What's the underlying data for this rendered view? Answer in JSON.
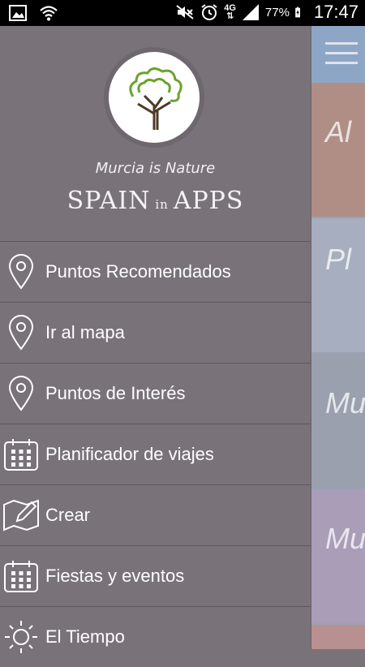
{
  "status_bar": {
    "network_type": "4G",
    "battery_percent": "77%",
    "time": "17:47",
    "icons": [
      "image-icon",
      "wifi-icon",
      "mute-icon",
      "alarm-icon",
      "signal-icon",
      "battery-charging-icon"
    ]
  },
  "drawer": {
    "tagline": "Murcia is Nature",
    "brand_main": "SPAIN",
    "brand_small": "in",
    "brand_end": "APPS",
    "items": [
      {
        "label": "Puntos Recomendados",
        "icon": "location-pin-icon"
      },
      {
        "label": "Ir al mapa",
        "icon": "location-pin-icon"
      },
      {
        "label": "Puntos de Interés",
        "icon": "location-pin-icon"
      },
      {
        "label": "Planificador de viajes",
        "icon": "calendar-icon"
      },
      {
        "label": "Crear",
        "icon": "edit-map-icon"
      },
      {
        "label": "Fiestas y eventos",
        "icon": "calendar-icon"
      },
      {
        "label": "El Tiempo",
        "icon": "sun-icon"
      }
    ]
  },
  "background": {
    "cards": [
      "Al",
      "Pl",
      "Mu",
      "Mu"
    ]
  },
  "colors": {
    "drawer_bg": "#7a7279",
    "status_bar_bg": "#000000",
    "tree_green": "#6aa32c"
  }
}
